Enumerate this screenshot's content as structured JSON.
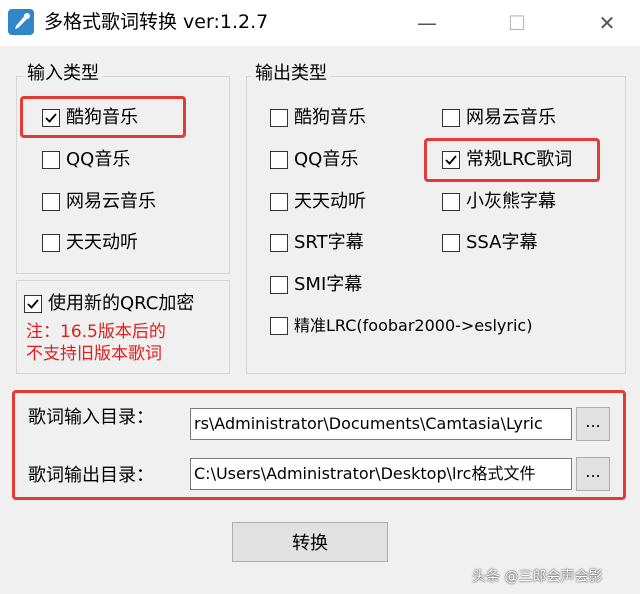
{
  "window": {
    "title": "多格式歌词转换   ver:1.2.7",
    "minimize_glyph": "—",
    "maximize_glyph": "☐",
    "close_glyph": "✕"
  },
  "input_group": {
    "legend": "输入类型",
    "options": [
      {
        "label": "酷狗音乐",
        "checked": true,
        "highlighted": true
      },
      {
        "label": "QQ音乐",
        "checked": false
      },
      {
        "label": "网易云音乐",
        "checked": false
      },
      {
        "label": "天天动听",
        "checked": false
      }
    ]
  },
  "qrc_option": {
    "label": "使用新的QRC加密",
    "checked": true,
    "note_line1": "注：16.5版本后的",
    "note_line2": "不支持旧版本歌词"
  },
  "output_group": {
    "legend": "输出类型",
    "options": [
      {
        "label": "酷狗音乐",
        "checked": false
      },
      {
        "label": "网易云音乐",
        "checked": false
      },
      {
        "label": "QQ音乐",
        "checked": false
      },
      {
        "label": "常规LRC歌词",
        "checked": true,
        "highlighted": true
      },
      {
        "label": "天天动听",
        "checked": false
      },
      {
        "label": "小灰熊字幕",
        "checked": false
      },
      {
        "label": "SRT字幕",
        "checked": false
      },
      {
        "label": "SSA字幕",
        "checked": false
      },
      {
        "label": "SMI字幕",
        "checked": false
      },
      {
        "label": "精准LRC(foobar2000->eslyric)",
        "checked": false
      }
    ]
  },
  "paths": {
    "input_label": "歌词输入目录：",
    "input_value": "rs\\Administrator\\Documents\\Camtasia\\Lyric",
    "output_label": "歌词输出目录：",
    "output_value": "C:\\Users\\Administrator\\Desktop\\lrc格式文件",
    "browse_label": "..."
  },
  "convert_button": "转换",
  "watermark": "头条 @三郎会声会影",
  "colors": {
    "highlight": "#e53935",
    "note_text": "#e02020",
    "background": "#f0f0f0"
  }
}
